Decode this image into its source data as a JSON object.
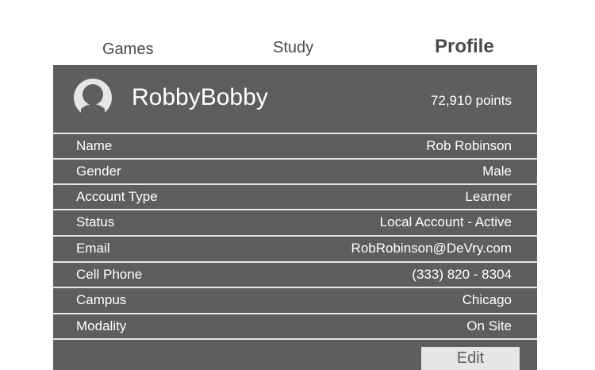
{
  "nav": {
    "tabs": [
      {
        "label": "Games"
      },
      {
        "label": "Study"
      },
      {
        "label": "Profile",
        "active": true
      }
    ]
  },
  "profile": {
    "username": "RobbyBobby",
    "points": "72,910 points",
    "avatar_icon": "user-avatar-icon",
    "fields": [
      {
        "label": "Name",
        "value": "Rob Robinson"
      },
      {
        "label": "Gender",
        "value": "Male"
      },
      {
        "label": "Account Type",
        "value": "Learner"
      },
      {
        "label": "Status",
        "value": "Local Account - Active"
      },
      {
        "label": "Email",
        "value": "RobRobinson@DeVry.com"
      },
      {
        "label": "Cell Phone",
        "value": "(333) 820 - 8304"
      },
      {
        "label": "Campus",
        "value": "Chicago"
      },
      {
        "label": "Modality",
        "value": "On Site"
      }
    ],
    "edit_label": "Edit"
  },
  "colors": {
    "panel": "#5e5e5e",
    "divider": "#e6e6e6",
    "tab_text": "#4a4a4a"
  }
}
